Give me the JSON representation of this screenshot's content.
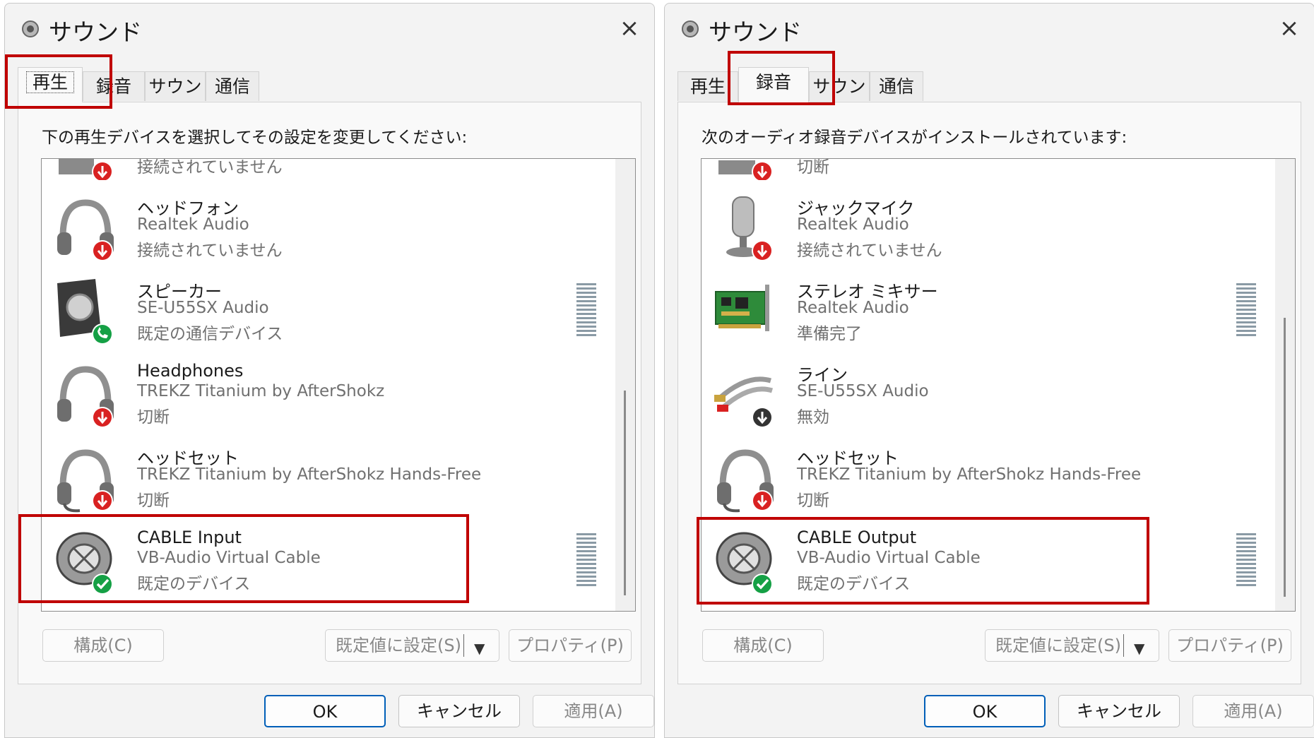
{
  "left": {
    "title": "サウンド",
    "close": "×",
    "tabs": [
      "再生",
      "録音",
      "サウンド",
      "通信"
    ],
    "instruction": "下の再生デバイスを選択してその設定を変更してください:",
    "devices": [
      {
        "name": "",
        "driver": "",
        "status": "接続されていません",
        "icon": "speaker-partial-icon"
      },
      {
        "name": "ヘッドフォン",
        "driver": "Realtek Audio",
        "status": "接続されていません",
        "icon": "headphones-icon"
      },
      {
        "name": "スピーカー",
        "driver": "SE-U55SX Audio",
        "status": "既定の通信デバイス",
        "icon": "speaker-icon"
      },
      {
        "name": "Headphones",
        "driver": "TREKZ Titanium by AfterShokz",
        "status": "切断",
        "icon": "headphones-icon"
      },
      {
        "name": "ヘッドセット",
        "driver": "TREKZ Titanium by AfterShokz Hands-Free",
        "status": "切断",
        "icon": "headset-icon"
      },
      {
        "name": "CABLE Input",
        "driver": "VB-Audio Virtual Cable",
        "status": "既定のデバイス",
        "icon": "cable-icon"
      }
    ],
    "buttons": {
      "configure": "構成(C)",
      "set_default": "既定値に設定(S)",
      "properties": "プロパティ(P)",
      "ok": "OK",
      "cancel": "キャンセル",
      "apply": "適用(A)"
    }
  },
  "right": {
    "title": "サウンド",
    "close": "×",
    "tabs": [
      "再生",
      "録音",
      "サウンド",
      "通信"
    ],
    "instruction": "次のオーディオ録音デバイスがインストールされています:",
    "devices": [
      {
        "name": "",
        "driver": "",
        "status": "切断",
        "icon": "mic-partial-icon"
      },
      {
        "name": "ジャックマイク",
        "driver": "Realtek Audio",
        "status": "接続されていません",
        "icon": "microphone-icon"
      },
      {
        "name": "ステレオ ミキサー",
        "driver": "Realtek Audio",
        "status": "準備完了",
        "icon": "sound-card-icon"
      },
      {
        "name": "ライン",
        "driver": "SE-U55SX Audio",
        "status": "無効",
        "icon": "rca-cable-icon"
      },
      {
        "name": "ヘッドセット",
        "driver": "TREKZ Titanium by AfterShokz Hands-Free",
        "status": "切断",
        "icon": "headset-icon"
      },
      {
        "name": "CABLE Output",
        "driver": "VB-Audio Virtual Cable",
        "status": "既定のデバイス",
        "icon": "cable-icon"
      }
    ],
    "buttons": {
      "configure": "構成(C)",
      "set_default": "既定値に設定(S)",
      "properties": "プロパティ(P)",
      "ok": "OK",
      "cancel": "キャンセル",
      "apply": "適用(A)"
    }
  },
  "colors": {
    "highlight": "#c00000",
    "focus": "#005fb8",
    "status_red": "#d92121",
    "status_green": "#15a045"
  }
}
